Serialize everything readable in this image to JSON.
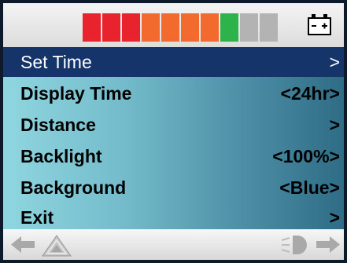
{
  "battery": {
    "segments": [
      {
        "color": "#e8232d"
      },
      {
        "color": "#e8232d"
      },
      {
        "color": "#e8232d"
      },
      {
        "color": "#f26a2e"
      },
      {
        "color": "#f26a2e"
      },
      {
        "color": "#f26a2e"
      },
      {
        "color": "#f26a2e"
      },
      {
        "color": "#2db34a"
      },
      {
        "color": "#b3b3b3"
      },
      {
        "color": "#b3b3b3"
      }
    ],
    "icon": "battery-icon"
  },
  "menu": {
    "items": [
      {
        "label": "Set Time",
        "value": ">"
      },
      {
        "label": "Display Time",
        "value": "<24hr>"
      },
      {
        "label": "Distance",
        "value": ">"
      },
      {
        "label": "Backlight",
        "value": "<100%>"
      },
      {
        "label": "Background",
        "value": "<Blue>"
      },
      {
        "label": "Exit",
        "value": ">"
      }
    ],
    "selected_index": 0,
    "selected_color": "#14346a"
  },
  "bottom_bar": {
    "icons": [
      "left-arrow-icon",
      "warning-triangle-icon",
      "horn-icon",
      "right-arrow-icon"
    ]
  }
}
